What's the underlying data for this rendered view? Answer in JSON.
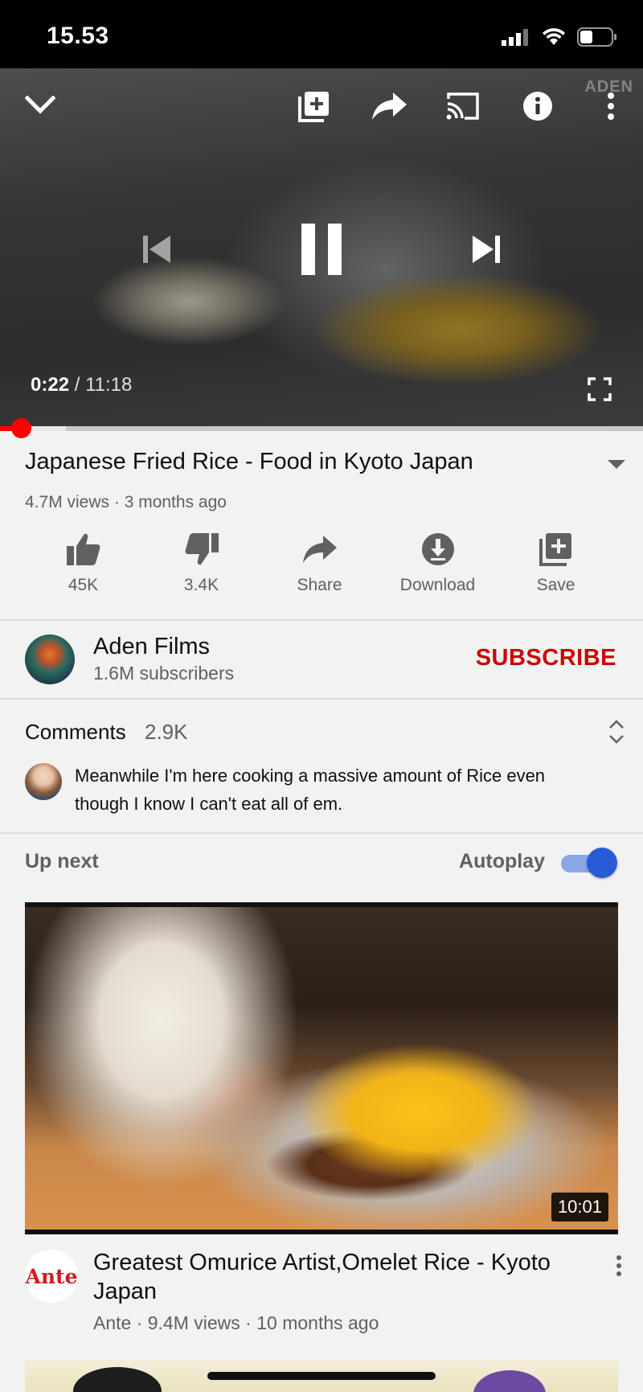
{
  "status_bar": {
    "time": "15.53"
  },
  "player": {
    "watermark": "ADEN",
    "current_time": "0:22",
    "separator": " / ",
    "duration": "11:18",
    "progress_fraction": 0.033
  },
  "video": {
    "title": "Japanese Fried Rice - Food in Kyoto Japan",
    "meta": "4.7M views · 3 months ago"
  },
  "actions": [
    {
      "icon": "thumbs-up-icon",
      "label": "45K"
    },
    {
      "icon": "thumbs-down-icon",
      "label": "3.4K"
    },
    {
      "icon": "share-icon",
      "label": "Share"
    },
    {
      "icon": "download-icon",
      "label": "Download"
    },
    {
      "icon": "save-icon",
      "label": "Save"
    }
  ],
  "channel": {
    "name": "Aden Films",
    "subscribers": "1.6M subscribers",
    "subscribe_label": "SUBSCRIBE"
  },
  "comments": {
    "title": "Comments",
    "count": "2.9K",
    "top_comment": "Meanwhile I'm here cooking a massive amount of Rice even though I know I can't eat all of em."
  },
  "up_next": {
    "label": "Up next",
    "autoplay_label": "Autoplay",
    "autoplay_on": true
  },
  "recommendation": {
    "duration": "10:01",
    "channel_logo_text": "Ante",
    "title": "Greatest Omurice Artist,Omelet Rice - Kyoto Japan",
    "meta": "Ante · 9.4M views · 10 months ago"
  },
  "colors": {
    "accent_red": "#ff0000",
    "subscribe_red": "#cc0000",
    "toggle_blue": "#2a5bd7"
  }
}
